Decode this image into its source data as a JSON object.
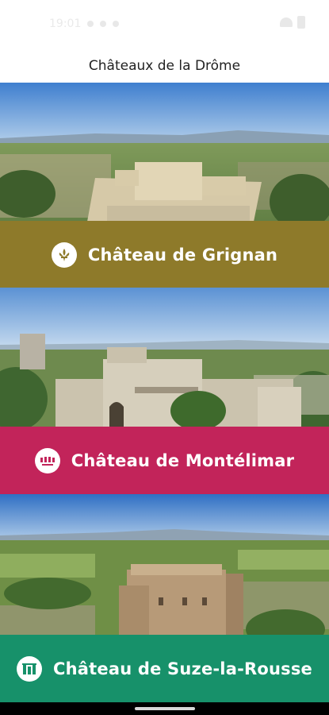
{
  "status_bar": {
    "time": "19:01"
  },
  "header": {
    "title": "Châteaux de la Drôme"
  },
  "cards": [
    {
      "label": "Château de Grignan",
      "band_color": "#8e7a2a",
      "emblem": "fleur-de-lis-icon"
    },
    {
      "label": "Château de Montélimar",
      "band_color": "#c2245a",
      "emblem": "montelimar-logo-icon"
    },
    {
      "label": "Château de Suze-la-Rousse",
      "band_color": "#17916a",
      "emblem": "suze-castle-icon"
    }
  ]
}
